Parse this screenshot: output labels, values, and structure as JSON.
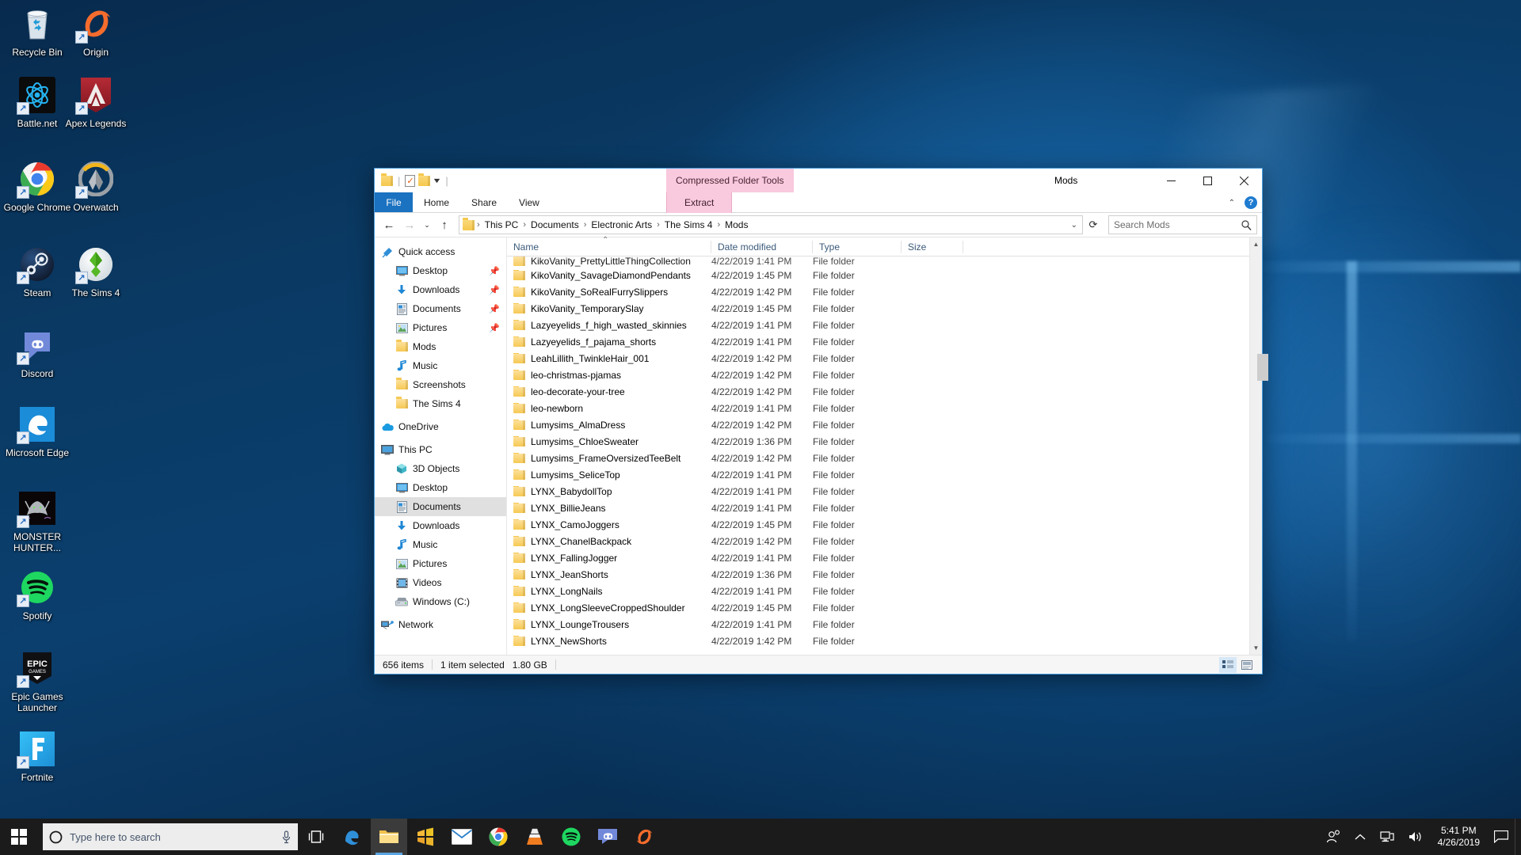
{
  "desktop": {
    "icons": [
      {
        "name": "Recycle Bin",
        "icon": "recycle-bin-icon",
        "shortcut": false
      },
      {
        "name": "Origin",
        "icon": "origin-icon",
        "shortcut": true
      },
      {
        "name": "Battle.net",
        "icon": "battlenet-icon",
        "shortcut": true
      },
      {
        "name": "Apex Legends",
        "icon": "apex-legends-icon",
        "shortcut": true
      },
      {
        "name": "Google Chrome",
        "icon": "chrome-icon",
        "shortcut": true
      },
      {
        "name": "Overwatch",
        "icon": "overwatch-icon",
        "shortcut": true
      },
      {
        "name": "Steam",
        "icon": "steam-icon",
        "shortcut": true
      },
      {
        "name": "The Sims 4",
        "icon": "sims4-icon",
        "shortcut": true
      },
      {
        "name": "Discord",
        "icon": "discord-icon",
        "shortcut": true
      },
      {
        "name": "Microsoft Edge",
        "icon": "edge-icon",
        "shortcut": true
      },
      {
        "name": "MONSTER HUNTER...",
        "icon": "monster-hunter-icon",
        "shortcut": true
      },
      {
        "name": "Spotify",
        "icon": "spotify-icon",
        "shortcut": true
      },
      {
        "name": "Epic Games Launcher",
        "icon": "epic-games-icon",
        "shortcut": true
      },
      {
        "name": "Fortnite",
        "icon": "fortnite-icon",
        "shortcut": true
      }
    ]
  },
  "explorer": {
    "title": "Mods",
    "context_tab_group": "Compressed Folder Tools",
    "quick_access_toolbar": [
      {
        "name": "properties-icon",
        "label": ""
      },
      {
        "name": "new-folder-icon",
        "label": ""
      },
      {
        "name": "customize-qat-icon",
        "label": ""
      }
    ],
    "window_controls": {
      "minimize": "minimize-button",
      "maximize": "maximize-button",
      "close": "close-button"
    },
    "ribbon": {
      "tabs": [
        "File",
        "Home",
        "Share",
        "View"
      ],
      "context_tabs": [
        "Extract"
      ],
      "minimize_ribbon": "chevron-up-icon",
      "help": "?"
    },
    "address": {
      "back": "back-arrow-icon",
      "forward": "forward-arrow-icon",
      "recent": "recent-locations-icon",
      "up": "up-arrow-icon",
      "breadcrumbs": [
        "This PC",
        "Documents",
        "Electronic Arts",
        "The Sims 4",
        "Mods"
      ],
      "dropdown": "chevron-down-icon",
      "refresh": "refresh-icon"
    },
    "search": {
      "placeholder": "Search Mods",
      "icon": "search-icon"
    },
    "nav_pane": [
      {
        "label": "Quick access",
        "icon": "pin-star-icon",
        "level": 0,
        "pinned": false,
        "selected": false
      },
      {
        "label": "Desktop",
        "icon": "desktop-icon",
        "level": 1,
        "pinned": true,
        "selected": false
      },
      {
        "label": "Downloads",
        "icon": "downloads-icon",
        "level": 1,
        "pinned": true,
        "selected": false
      },
      {
        "label": "Documents",
        "icon": "documents-icon",
        "level": 1,
        "pinned": true,
        "selected": false
      },
      {
        "label": "Pictures",
        "icon": "pictures-icon",
        "level": 1,
        "pinned": true,
        "selected": false
      },
      {
        "label": "Mods",
        "icon": "folder-icon",
        "level": 1,
        "pinned": false,
        "selected": false
      },
      {
        "label": "Music",
        "icon": "music-icon",
        "level": 1,
        "pinned": false,
        "selected": false
      },
      {
        "label": "Screenshots",
        "icon": "folder-icon",
        "level": 1,
        "pinned": false,
        "selected": false
      },
      {
        "label": "The Sims 4",
        "icon": "folder-icon",
        "level": 1,
        "pinned": false,
        "selected": false
      },
      {
        "label": "OneDrive",
        "icon": "onedrive-icon",
        "level": 0,
        "pinned": false,
        "selected": false
      },
      {
        "label": "This PC",
        "icon": "thispc-icon",
        "level": 0,
        "pinned": false,
        "selected": false
      },
      {
        "label": "3D Objects",
        "icon": "3dobjects-icon",
        "level": 1,
        "pinned": false,
        "selected": false
      },
      {
        "label": "Desktop",
        "icon": "desktop-icon",
        "level": 1,
        "pinned": false,
        "selected": false
      },
      {
        "label": "Documents",
        "icon": "documents-icon",
        "level": 1,
        "pinned": false,
        "selected": true
      },
      {
        "label": "Downloads",
        "icon": "downloads-icon",
        "level": 1,
        "pinned": false,
        "selected": false
      },
      {
        "label": "Music",
        "icon": "music-icon",
        "level": 1,
        "pinned": false,
        "selected": false
      },
      {
        "label": "Pictures",
        "icon": "pictures-icon",
        "level": 1,
        "pinned": false,
        "selected": false
      },
      {
        "label": "Videos",
        "icon": "videos-icon",
        "level": 1,
        "pinned": false,
        "selected": false
      },
      {
        "label": "Windows (C:)",
        "icon": "drive-icon",
        "level": 1,
        "pinned": false,
        "selected": false
      },
      {
        "label": "Network",
        "icon": "network-icon",
        "level": 0,
        "pinned": false,
        "selected": false
      }
    ],
    "columns": [
      {
        "label": "Name",
        "sorted": true
      },
      {
        "label": "Date modified",
        "sorted": false
      },
      {
        "label": "Type",
        "sorted": false
      },
      {
        "label": "Size",
        "sorted": false
      }
    ],
    "files": [
      {
        "name": "KikoVanity_PrettyLittleThingCollection",
        "date": "4/22/2019 1:41 PM",
        "type": "File folder",
        "size": ""
      },
      {
        "name": "KikoVanity_SavageDiamondPendants",
        "date": "4/22/2019 1:45 PM",
        "type": "File folder",
        "size": ""
      },
      {
        "name": "KikoVanity_SoRealFurrySlippers",
        "date": "4/22/2019 1:42 PM",
        "type": "File folder",
        "size": ""
      },
      {
        "name": "KikoVanity_TemporarySlay",
        "date": "4/22/2019 1:45 PM",
        "type": "File folder",
        "size": ""
      },
      {
        "name": "Lazyeyelids_f_high_wasted_skinnies",
        "date": "4/22/2019 1:41 PM",
        "type": "File folder",
        "size": ""
      },
      {
        "name": "Lazyeyelids_f_pajama_shorts",
        "date": "4/22/2019 1:41 PM",
        "type": "File folder",
        "size": ""
      },
      {
        "name": "LeahLillith_TwinkleHair_001",
        "date": "4/22/2019 1:42 PM",
        "type": "File folder",
        "size": ""
      },
      {
        "name": "leo-christmas-pjamas",
        "date": "4/22/2019 1:42 PM",
        "type": "File folder",
        "size": ""
      },
      {
        "name": "leo-decorate-your-tree",
        "date": "4/22/2019 1:42 PM",
        "type": "File folder",
        "size": ""
      },
      {
        "name": "leo-newborn",
        "date": "4/22/2019 1:41 PM",
        "type": "File folder",
        "size": ""
      },
      {
        "name": "Lumysims_AlmaDress",
        "date": "4/22/2019 1:42 PM",
        "type": "File folder",
        "size": ""
      },
      {
        "name": "Lumysims_ChloeSweater",
        "date": "4/22/2019 1:36 PM",
        "type": "File folder",
        "size": ""
      },
      {
        "name": "Lumysims_FrameOversizedTeeBelt",
        "date": "4/22/2019 1:42 PM",
        "type": "File folder",
        "size": ""
      },
      {
        "name": "Lumysims_SeliceTop",
        "date": "4/22/2019 1:41 PM",
        "type": "File folder",
        "size": ""
      },
      {
        "name": "LYNX_BabydollTop",
        "date": "4/22/2019 1:41 PM",
        "type": "File folder",
        "size": ""
      },
      {
        "name": "LYNX_BillieJeans",
        "date": "4/22/2019 1:41 PM",
        "type": "File folder",
        "size": ""
      },
      {
        "name": "LYNX_CamoJoggers",
        "date": "4/22/2019 1:45 PM",
        "type": "File folder",
        "size": ""
      },
      {
        "name": "LYNX_ChanelBackpack",
        "date": "4/22/2019 1:42 PM",
        "type": "File folder",
        "size": ""
      },
      {
        "name": "LYNX_FallingJogger",
        "date": "4/22/2019 1:41 PM",
        "type": "File folder",
        "size": ""
      },
      {
        "name": "LYNX_JeanShorts",
        "date": "4/22/2019 1:36 PM",
        "type": "File folder",
        "size": ""
      },
      {
        "name": "LYNX_LongNails",
        "date": "4/22/2019 1:41 PM",
        "type": "File folder",
        "size": ""
      },
      {
        "name": "LYNX_LongSleeveCroppedShoulder",
        "date": "4/22/2019 1:45 PM",
        "type": "File folder",
        "size": ""
      },
      {
        "name": "LYNX_LoungeTrousers",
        "date": "4/22/2019 1:41 PM",
        "type": "File folder",
        "size": ""
      },
      {
        "name": "LYNX_NewShorts",
        "date": "4/22/2019 1:42 PM",
        "type": "File folder",
        "size": ""
      }
    ],
    "status": {
      "item_count": "656 items",
      "selection": "1 item selected",
      "selection_size": "1.80 GB",
      "view_details": "details-view-button",
      "view_large": "large-icons-view-button"
    }
  },
  "taskbar": {
    "start": "windows-start-icon",
    "search_placeholder": "Type here to search",
    "search_icon": "cortana-circle-icon",
    "mic_icon": "microphone-icon",
    "taskview": "task-view-icon",
    "apps": [
      {
        "name": "edge-taskbar-icon",
        "label": "Microsoft Edge"
      },
      {
        "name": "file-explorer-taskbar-icon",
        "label": "File Explorer"
      },
      {
        "name": "microsoft-store-taskbar-icon",
        "label": "Microsoft Store"
      },
      {
        "name": "mail-taskbar-icon",
        "label": "Mail"
      },
      {
        "name": "chrome-taskbar-icon",
        "label": "Google Chrome"
      },
      {
        "name": "vlc-taskbar-icon",
        "label": "VLC"
      },
      {
        "name": "spotify-taskbar-icon",
        "label": "Spotify"
      },
      {
        "name": "discord-taskbar-icon",
        "label": "Discord"
      },
      {
        "name": "origin-taskbar-icon",
        "label": "Origin"
      }
    ],
    "tray": [
      {
        "name": "people-icon"
      },
      {
        "name": "show-hidden-icons-chevron"
      },
      {
        "name": "network-tray-icon"
      },
      {
        "name": "volume-tray-icon"
      }
    ],
    "time": "5:41 PM",
    "date": "4/26/2019",
    "action_center": "action-center-icon"
  },
  "colors": {
    "accent": "#0078d7",
    "window_border": "#4a9ddb",
    "context_tab": "#f9c9de",
    "file_tab": "#1b72c0",
    "folder_yellow": "#f6c955"
  }
}
